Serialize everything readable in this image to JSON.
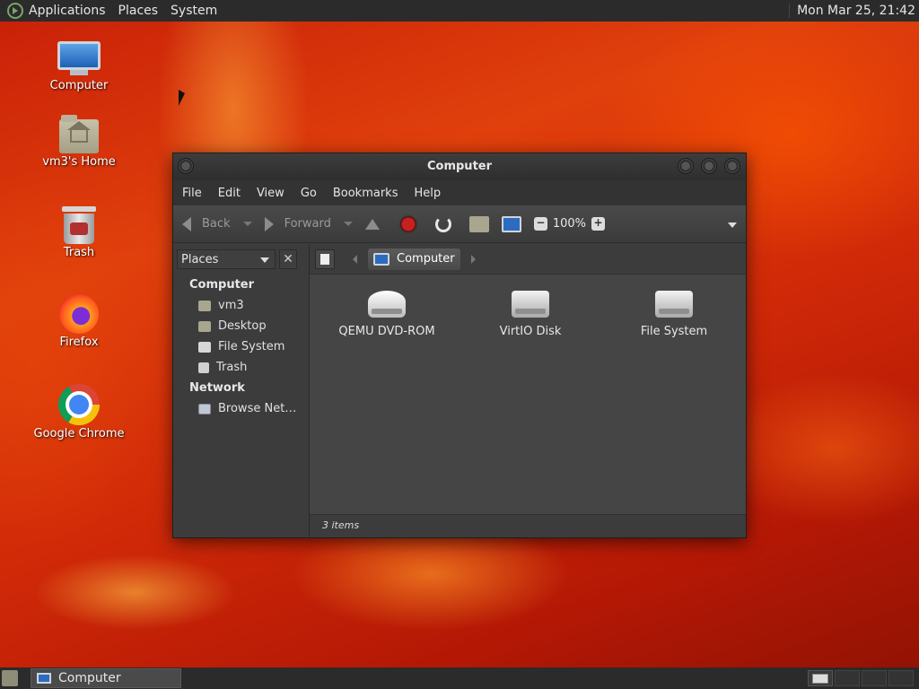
{
  "top_panel": {
    "menus": [
      "Applications",
      "Places",
      "System"
    ],
    "clock": "Mon Mar 25, 21:42"
  },
  "desktop_icons": [
    {
      "label": "Computer",
      "icon": "computer-icon"
    },
    {
      "label": "vm3's Home",
      "icon": "home-folder-icon"
    },
    {
      "label": "Trash",
      "icon": "trash-icon"
    },
    {
      "label": "Firefox",
      "icon": "firefox-icon"
    },
    {
      "label": "Google Chrome",
      "icon": "chrome-icon"
    }
  ],
  "window": {
    "title": "Computer",
    "menubar": [
      "File",
      "Edit",
      "View",
      "Go",
      "Bookmarks",
      "Help"
    ],
    "toolbar": {
      "back": "Back",
      "forward": "Forward",
      "zoom": "100%"
    },
    "sidebar": {
      "selector": "Places",
      "sections": [
        {
          "heading": "Computer",
          "items": [
            "vm3",
            "Desktop",
            "File System",
            "Trash"
          ]
        },
        {
          "heading": "Network",
          "items": [
            "Browse Net…"
          ]
        }
      ]
    },
    "pathbar": {
      "crumb": "Computer"
    },
    "files": [
      "QEMU DVD-ROM",
      "VirtIO Disk",
      "File System"
    ],
    "status": "3 items"
  },
  "bottom_panel": {
    "task": "Computer"
  }
}
